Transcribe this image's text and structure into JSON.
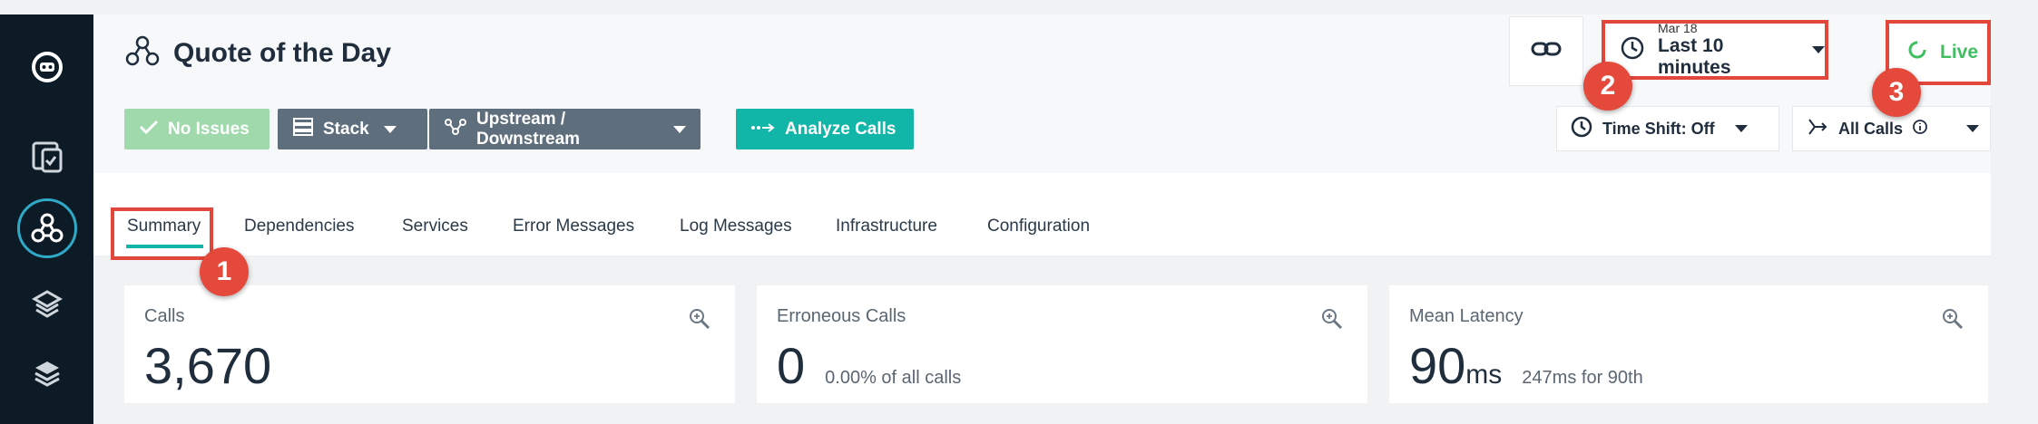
{
  "header": {
    "title": "Quote of the Day",
    "no_issues_label": "No Issues",
    "stack_label": "Stack",
    "upstream_label": "Upstream / Downstream",
    "analyze_label": "Analyze Calls",
    "time_range": {
      "date": "Mar 18",
      "range": "Last 10 minutes"
    },
    "live_label": "Live",
    "time_shift_label": "Time Shift: Off",
    "all_calls_label": "All Calls"
  },
  "tabs": [
    {
      "label": "Summary",
      "active": true
    },
    {
      "label": "Dependencies"
    },
    {
      "label": "Services"
    },
    {
      "label": "Error Messages"
    },
    {
      "label": "Log Messages"
    },
    {
      "label": "Infrastructure"
    },
    {
      "label": "Configuration"
    }
  ],
  "metrics": {
    "calls": {
      "label": "Calls",
      "value": "3,670"
    },
    "erroneous": {
      "label": "Erroneous Calls",
      "value": "0",
      "sub": "0.00% of all calls"
    },
    "latency": {
      "label": "Mean Latency",
      "value": "90",
      "unit": "ms",
      "sub": "247ms for 90th"
    }
  },
  "badges": {
    "one": "1",
    "two": "2",
    "three": "3"
  },
  "colors": {
    "accent": "#12b6a8",
    "highlight": "#e2473c",
    "nav": "#0d1b26",
    "live": "#3fbf5f"
  },
  "icons": [
    "robot-logo-icon",
    "monitor-apps-icon",
    "services-icon",
    "layers-stack-icon",
    "cube-stack-icon",
    "link-icon",
    "clock-icon",
    "refresh-icon",
    "check-icon",
    "stack-icon",
    "network-icon",
    "analyze-arrows-icon",
    "zoom-icon"
  ]
}
